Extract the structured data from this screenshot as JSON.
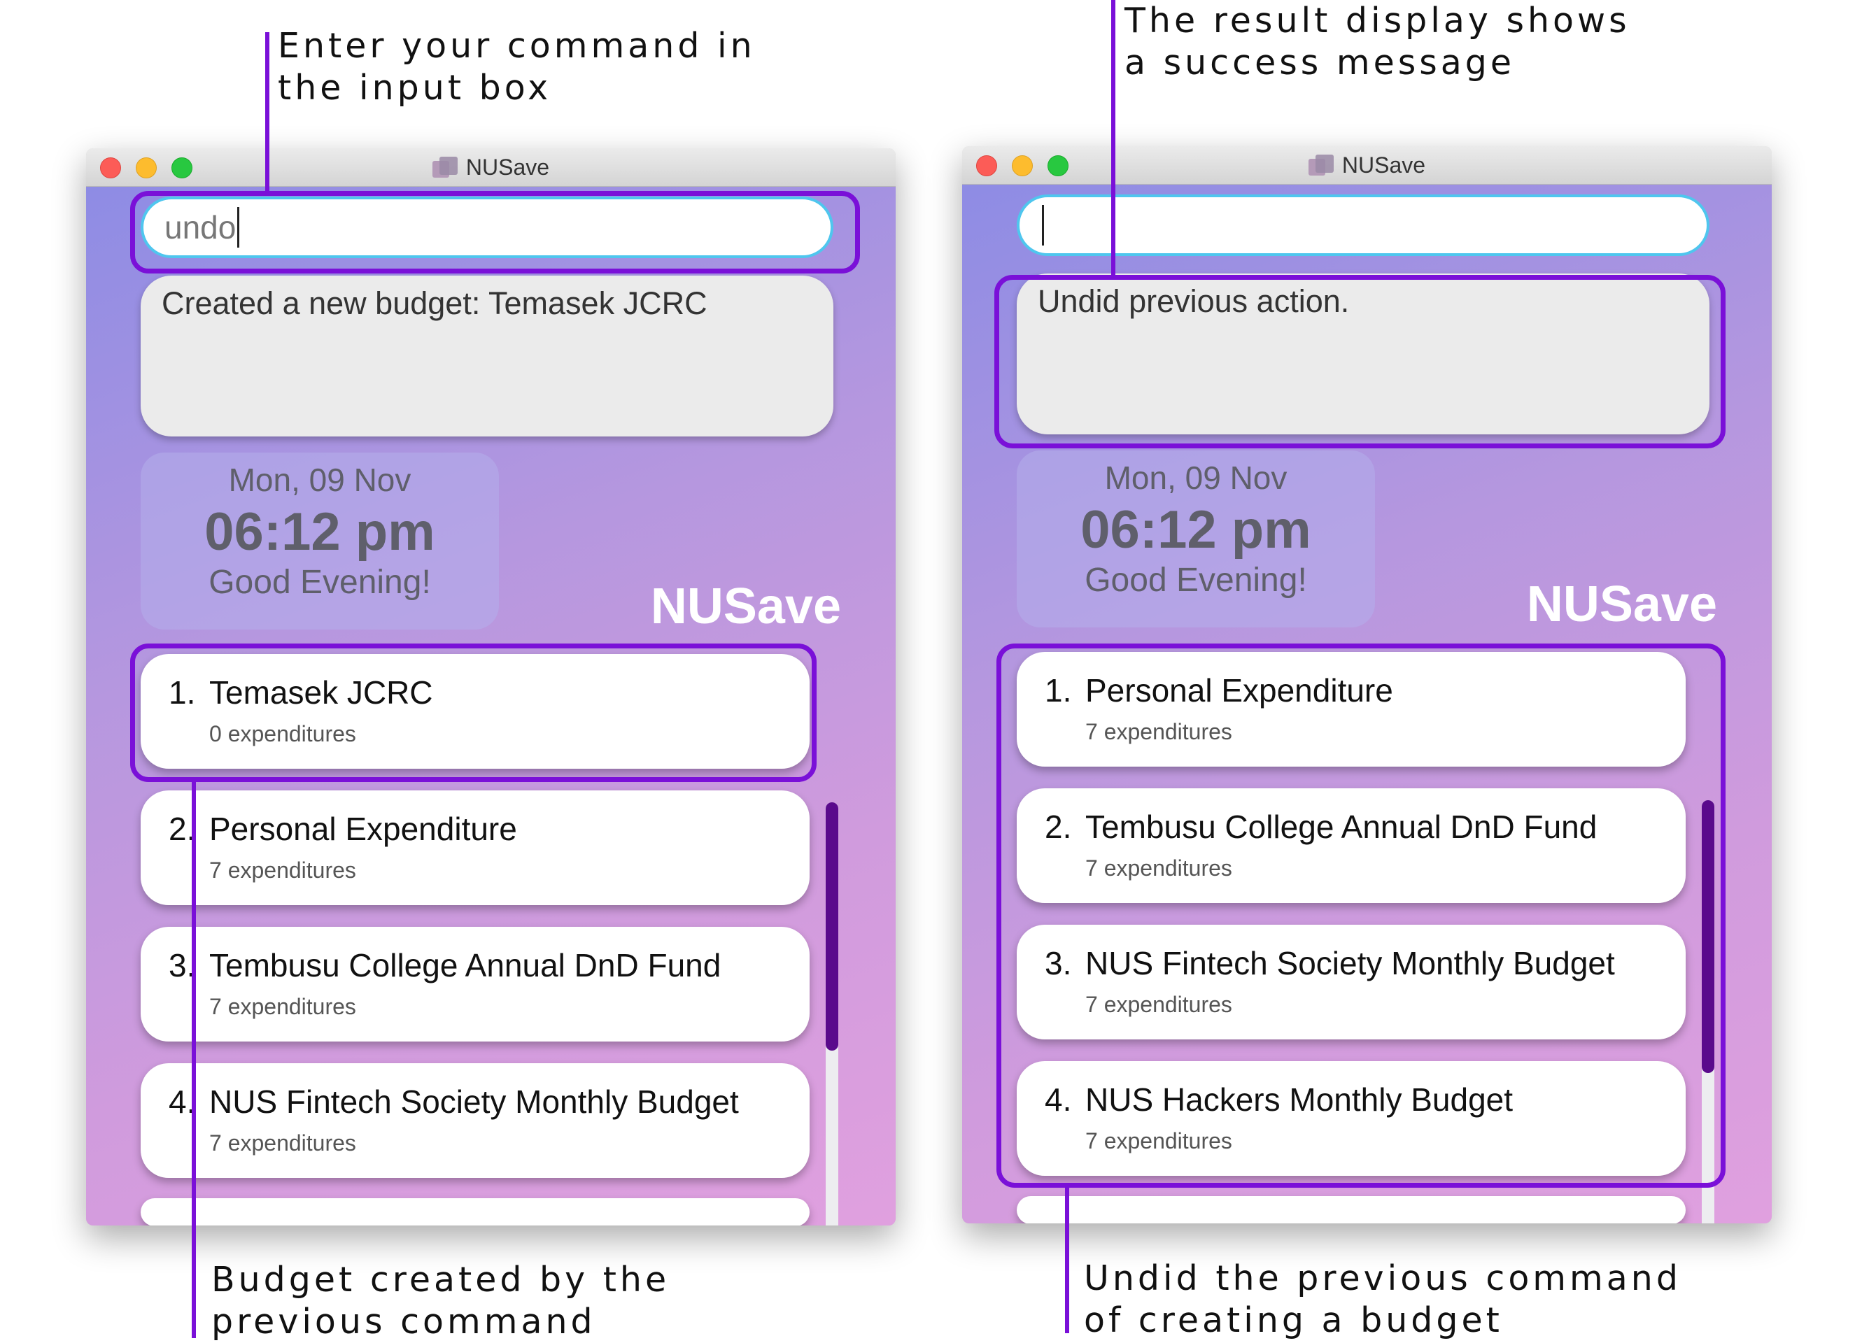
{
  "annotations": {
    "input_note": "Enter your command in\nthe input box",
    "result_note": "The result display shows\na success message",
    "created_note": "Budget created by the\nprevious command",
    "undid_note": "Undid the previous command\nof creating a budget"
  },
  "left_window": {
    "title": "NUSave",
    "command_value": "undo",
    "result_text": "Created a new budget: Temasek JCRC",
    "clock": {
      "date": "Mon, 09 Nov",
      "time": "06:12 pm",
      "greeting": "Good Evening!"
    },
    "brand": "NUSave",
    "budgets": [
      {
        "index": "1.",
        "name": "Temasek JCRC",
        "count": "0 expenditures"
      },
      {
        "index": "2.",
        "name": "Personal Expenditure",
        "count": "7 expenditures"
      },
      {
        "index": "3.",
        "name": "Tembusu College Annual DnD Fund",
        "count": "7 expenditures"
      },
      {
        "index": "4.",
        "name": "NUS Fintech Society Monthly Budget",
        "count": "7 expenditures"
      }
    ]
  },
  "right_window": {
    "title": "NUSave",
    "command_value": "",
    "result_text": "Undid previous action.",
    "clock": {
      "date": "Mon, 09 Nov",
      "time": "06:12 pm",
      "greeting": "Good Evening!"
    },
    "brand": "NUSave",
    "budgets": [
      {
        "index": "1.",
        "name": "Personal Expenditure",
        "count": "7 expenditures"
      },
      {
        "index": "2.",
        "name": "Tembusu College Annual DnD Fund",
        "count": "7 expenditures"
      },
      {
        "index": "3.",
        "name": "NUS Fintech Society Monthly Budget",
        "count": "7 expenditures"
      },
      {
        "index": "4.",
        "name": "NUS Hackers Monthly Budget",
        "count": "7 expenditures"
      }
    ]
  },
  "colors": {
    "highlight": "#7a10d8",
    "input_border": "#4fc6ee",
    "scroll_thumb": "#5a0a8c"
  }
}
